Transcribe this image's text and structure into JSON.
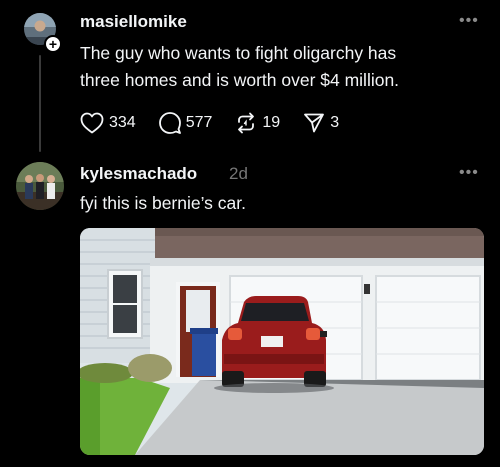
{
  "post1": {
    "username": "masiellomike",
    "text_line1": "The guy who wants to fight oligarchy has",
    "text_line2": "three homes and is worth over $4 million.",
    "more": "•••",
    "follow_symbol": "+",
    "likes": "334",
    "comments": "577",
    "reposts": "19",
    "shares": "3"
  },
  "post2": {
    "username": "kylesmachado",
    "time": "2d",
    "text": "fyi this is bernie’s car.",
    "more": "•••",
    "plate_text": "",
    "image_icon": "photo-house-car"
  }
}
